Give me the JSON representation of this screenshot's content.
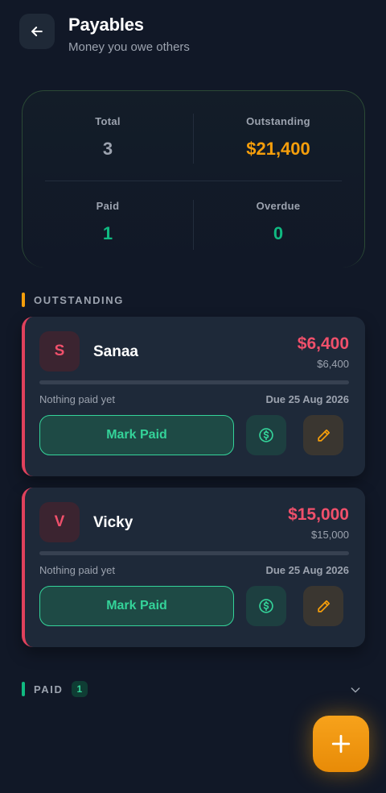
{
  "header": {
    "title": "Payables",
    "subtitle": "Money you owe others",
    "back_icon": "arrow-left-icon"
  },
  "summary": {
    "total": {
      "label": "Total",
      "value": "3"
    },
    "outstanding": {
      "label": "Outstanding",
      "value": "$21,400"
    },
    "paid": {
      "label": "Paid",
      "value": "1"
    },
    "overdue": {
      "label": "Overdue",
      "value": "0"
    }
  },
  "colors": {
    "outstanding_accent": "#f59e0b",
    "paid_accent": "#10b981",
    "overdue_accent": "#10b981",
    "danger": "#f0506b",
    "success": "#34d399",
    "fab": "#f59e0b"
  },
  "sections": {
    "outstanding": {
      "title": "OUTSTANDING"
    },
    "paid": {
      "title": "PAID",
      "count": "1",
      "chevron_icon": "chevron-down-icon"
    }
  },
  "payables": [
    {
      "initial": "S",
      "name": "Sanaa",
      "amount": "$6,400",
      "remaining": "$6,400",
      "progress_fraction": 0,
      "paid_note": "Nothing paid yet",
      "due": "Due 25 Aug 2026",
      "mark_paid_label": "Mark Paid",
      "pay_icon": "dollar-circle-icon",
      "edit_icon": "pencil-icon"
    },
    {
      "initial": "V",
      "name": "Vicky",
      "amount": "$15,000",
      "remaining": "$15,000",
      "progress_fraction": 0,
      "paid_note": "Nothing paid yet",
      "due": "Due 25 Aug 2026",
      "mark_paid_label": "Mark Paid",
      "pay_icon": "dollar-circle-icon",
      "edit_icon": "pencil-icon"
    }
  ],
  "fab": {
    "icon": "plus-icon"
  }
}
